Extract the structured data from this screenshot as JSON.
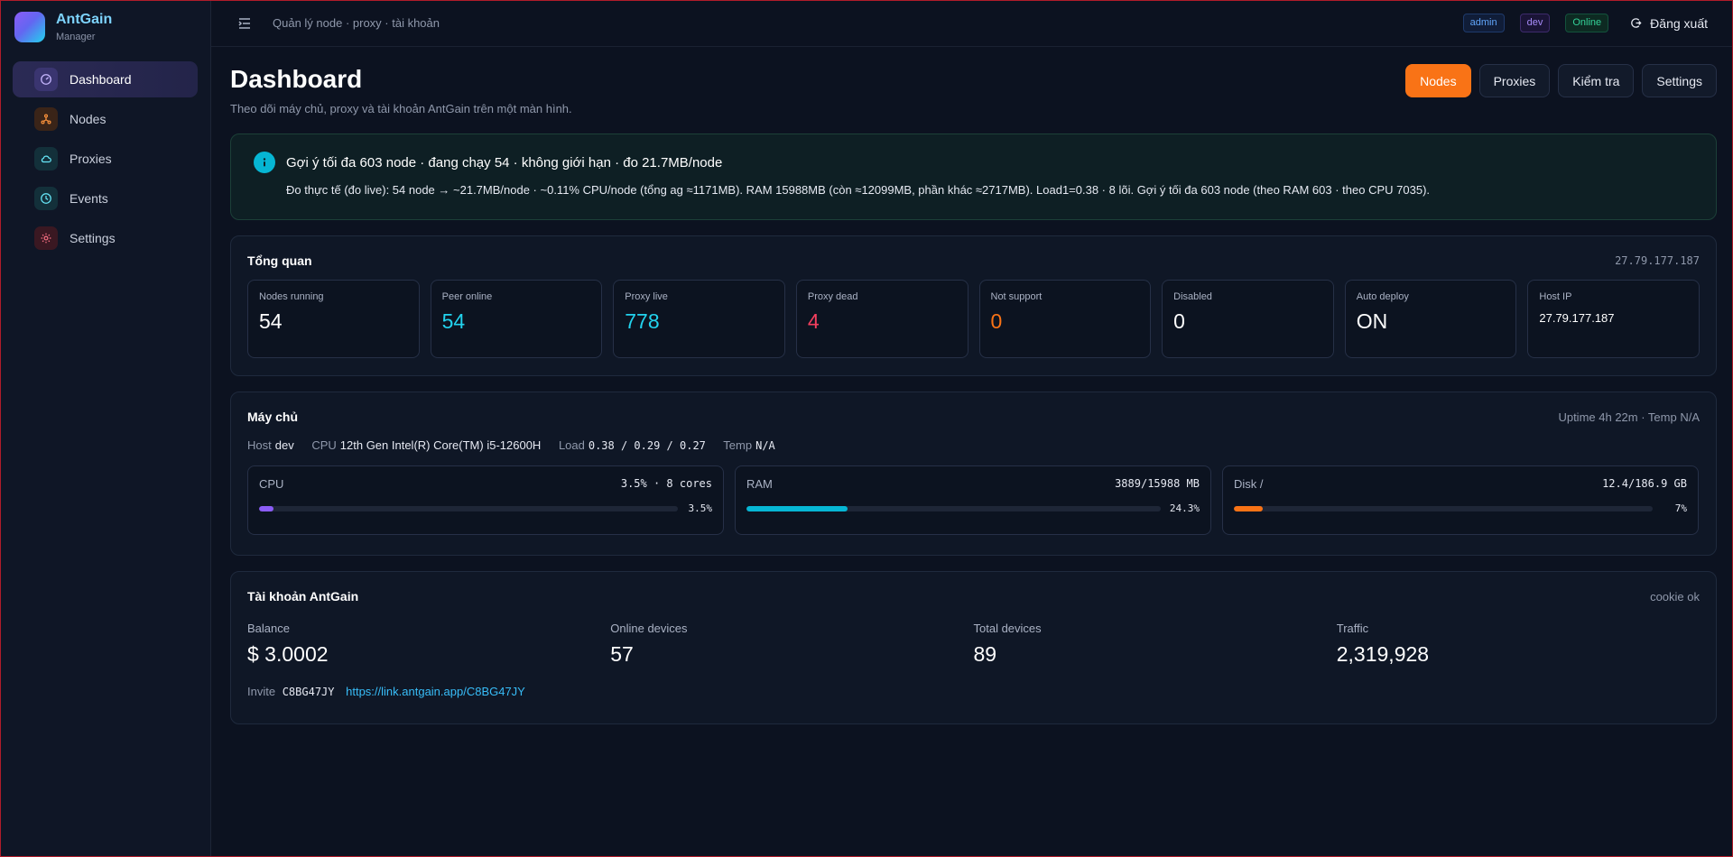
{
  "brand": {
    "title": "AntGain",
    "subtitle": "Manager"
  },
  "sidebar": {
    "items": [
      {
        "label": "Dashboard",
        "icon": "gauge-icon",
        "color": "#6366f1"
      },
      {
        "label": "Nodes",
        "icon": "network-icon",
        "color": "#f97316"
      },
      {
        "label": "Proxies",
        "icon": "cloud-icon",
        "color": "#22d3ee"
      },
      {
        "label": "Events",
        "icon": "clock-icon",
        "color": "#22d3ee"
      },
      {
        "label": "Settings",
        "icon": "gear-icon",
        "color": "#f43f5e"
      }
    ]
  },
  "topbar": {
    "breadcrumb": "Quản lý node · proxy · tài khoản",
    "badges": {
      "admin": "admin",
      "dev": "dev",
      "online": "Online"
    },
    "logout": "Đăng xuất"
  },
  "header": {
    "title": "Dashboard",
    "subtitle": "Theo dõi máy chủ, proxy và tài khoản AntGain trên một màn hình.",
    "buttons": {
      "nodes": "Nodes",
      "proxies": "Proxies",
      "check": "Kiểm tra",
      "settings": "Settings"
    }
  },
  "alert": {
    "title": "Gợi ý tối đa 603 node · đang chạy 54 · không giới hạn · đo 21.7MB/node",
    "detail": "Đo thực tế (đo live): 54 node → ~21.7MB/node · ~0.11% CPU/node (tổng ag ≈1171MB). RAM 15988MB (còn ≈12099MB, phần khác ≈2717MB). Load1=0.38 · 8 lõi. Gợi ý tối đa 603 node (theo RAM 603 · theo CPU 7035)."
  },
  "overview": {
    "title": "Tổng quan",
    "ip": "27.79.177.187",
    "stats": [
      {
        "label": "Nodes running",
        "value": "54"
      },
      {
        "label": "Peer online",
        "value": "54"
      },
      {
        "label": "Proxy live",
        "value": "778"
      },
      {
        "label": "Proxy dead",
        "value": "4"
      },
      {
        "label": "Not support",
        "value": "0"
      },
      {
        "label": "Disabled",
        "value": "0"
      },
      {
        "label": "Auto deploy",
        "value": "ON"
      },
      {
        "label": "Host IP",
        "value": "27.79.177.187"
      }
    ]
  },
  "server": {
    "title": "Máy chủ",
    "uptime": "Uptime 4h 22m · Temp N/A",
    "host_label": "Host",
    "host": "dev",
    "cpu_label": "CPU",
    "cpu_model": "12th Gen Intel(R) Core(TM) i5-12600H",
    "load_label": "Load",
    "load": "0.38 / 0.29 / 0.27",
    "temp_label": "Temp",
    "temp": "N/A",
    "resources": [
      {
        "label": "CPU",
        "value": "3.5% · 8 cores",
        "pct_text": "3.5%",
        "pct": 3.5,
        "color": "#8b5cf6"
      },
      {
        "label": "RAM",
        "value": "3889/15988 MB",
        "pct_text": "24.3%",
        "pct": 24.3,
        "color": "#06b6d4"
      },
      {
        "label": "Disk /",
        "value": "12.4/186.9 GB",
        "pct_text": "7%",
        "pct": 7,
        "color": "#f97316"
      }
    ]
  },
  "account": {
    "title": "Tài khoản AntGain",
    "status": "cookie ok",
    "metrics": [
      {
        "label": "Balance",
        "value": "$ 3.0002"
      },
      {
        "label": "Online devices",
        "value": "57"
      },
      {
        "label": "Total devices",
        "value": "89"
      },
      {
        "label": "Traffic",
        "value": "2,319,928"
      }
    ],
    "invite_label": "Invite",
    "invite_code": "C8BG47JY",
    "invite_link": "https://link.antgain.app/C8BG47JY"
  }
}
